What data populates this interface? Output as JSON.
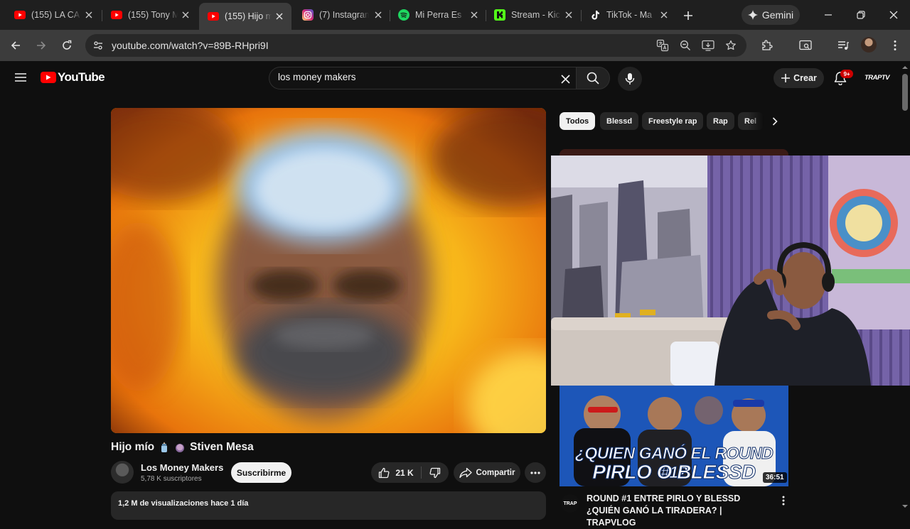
{
  "browser": {
    "tabs": [
      {
        "title": "(155) LA CA",
        "favicon": "youtube-icon"
      },
      {
        "title": "(155) Tony M",
        "favicon": "youtube-icon"
      },
      {
        "title": "(155) Hijo m",
        "favicon": "youtube-icon",
        "active": true
      },
      {
        "title": "(7) Instagram",
        "favicon": "instagram-icon"
      },
      {
        "title": "Mi Perra Es",
        "favicon": "spotify-icon"
      },
      {
        "title": "Stream - Kic",
        "favicon": "kick-icon"
      },
      {
        "title": "TikTok - Ma",
        "favicon": "tiktok-icon"
      }
    ],
    "gemini_label": "Gemini",
    "url": "youtube.com/watch?v=89B-RHpri9I"
  },
  "youtube": {
    "logo_text": "YouTube",
    "search_value": "los money makers",
    "create_label": "Crear",
    "notifications_badge": "9+",
    "channel_logo": "TRAPTV"
  },
  "video": {
    "title": "Hijo mío",
    "artist": "Stiven Mesa",
    "channel_name": "Los Money Makers",
    "subscribers": "5,78 K suscriptores",
    "subscribe_label": "Suscribirme",
    "likes": "21 K",
    "share_label": "Compartir",
    "meta": "1,2 M de visualizaciones  hace 1 día"
  },
  "chips": [
    "Todos",
    "Blessd",
    "Freestyle rap",
    "Rap",
    "Rel"
  ],
  "recommendation": {
    "headline_line1": "¿QUIEN GANÓ EL ROUND #1?",
    "headline_line2": "PIRLO O BLESSD",
    "duration": "36:51",
    "title": "ROUND #1 ENTRE PIRLO Y BLESSD ¿QUIÉN GANÓ LA TIRADERA? | TRAPVLOG",
    "channel_badge": "TRAP"
  },
  "colors": {
    "youtube_red": "#ff0000",
    "background": "#0f0f0f",
    "chrome_tabbar": "#1f1f1f",
    "chrome_toolbar": "#3c3c3c",
    "video_flame_yellow": "#f6c21a",
    "video_flame_orange": "#e8740c"
  }
}
